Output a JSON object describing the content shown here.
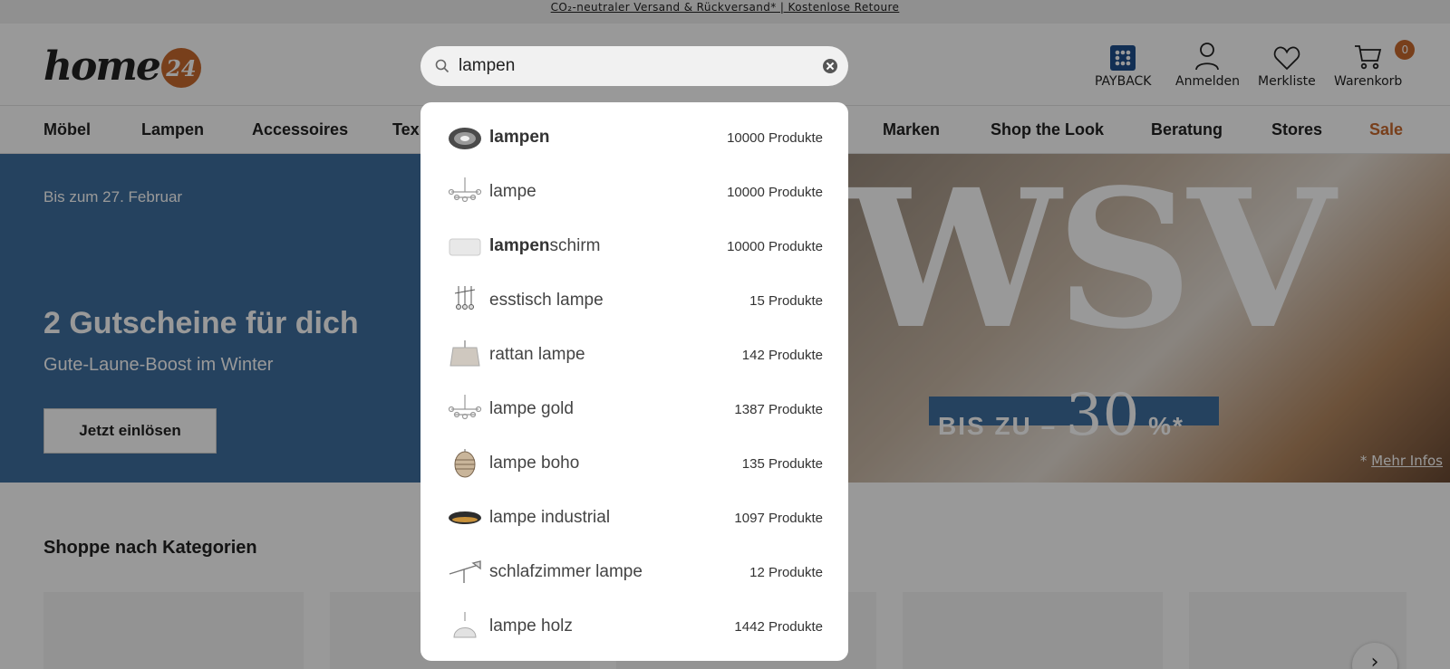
{
  "topbar": {
    "text": "CO₂-neutraler Versand & Rückversand* | Kostenlose Retoure"
  },
  "header": {
    "logo_text": "home",
    "logo_badge": "24",
    "search": {
      "value": "lampen",
      "placeholder": ""
    },
    "actions": [
      {
        "label": "PAYBACK",
        "icon": "payback-icon"
      },
      {
        "label": "Anmelden",
        "icon": "user-icon"
      },
      {
        "label": "Merkliste",
        "icon": "heart-icon"
      },
      {
        "label": "Warenkorb",
        "icon": "cart-icon",
        "count": "0"
      }
    ]
  },
  "nav": {
    "items": [
      "Möbel",
      "Lampen",
      "Accessoires",
      "Tex",
      "Marken",
      "Shop the Look",
      "Beratung",
      "Stores",
      "Sale"
    ]
  },
  "hero": {
    "date": "Bis zum 27. Februar",
    "title": "2 Gutscheine für dich",
    "subtitle": "Gute-Laune-Boost im Winter",
    "button": "Jetzt einlösen",
    "brand": "WSV",
    "promo_prefix": "BIS ZU",
    "promo_dash": "–",
    "promo_value": "30",
    "promo_suffix": "%*",
    "mehr_prefix": "*",
    "mehr_link": "Mehr Infos"
  },
  "categories": {
    "title": "Shoppe nach Kategorien",
    "next_icon": "chevron-right-icon"
  },
  "suggestions": [
    {
      "bold": "lampen",
      "rest": "",
      "count": "10000 Produkte",
      "icon": "pendant-lamp-icon"
    },
    {
      "bold": "",
      "rest": "lampe",
      "count": "10000 Produkte",
      "icon": "chandelier-icon"
    },
    {
      "bold": "lampen",
      "rest": "schirm",
      "count": "10000 Produkte",
      "icon": "lampshade-icon"
    },
    {
      "bold": "",
      "rest": "esstisch lampe",
      "count": "15 Produkte",
      "icon": "hanging-lamps-icon"
    },
    {
      "bold": "",
      "rest": "rattan lampe",
      "count": "142 Produkte",
      "icon": "rattan-lamp-icon"
    },
    {
      "bold": "",
      "rest": "lampe gold",
      "count": "1387 Produkte",
      "icon": "chandelier-icon"
    },
    {
      "bold": "",
      "rest": "lampe boho",
      "count": "135 Produkte",
      "icon": "boho-lamp-icon"
    },
    {
      "bold": "",
      "rest": "lampe industrial",
      "count": "1097 Produkte",
      "icon": "ring-lamp-icon"
    },
    {
      "bold": "",
      "rest": "schlafzimmer lampe",
      "count": "12 Produkte",
      "icon": "wall-lamp-icon"
    },
    {
      "bold": "",
      "rest": "lampe holz",
      "count": "1442 Produkte",
      "icon": "dome-lamp-icon"
    }
  ]
}
